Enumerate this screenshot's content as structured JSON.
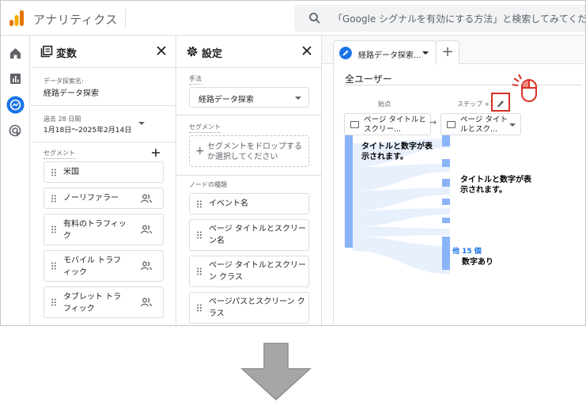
{
  "app": {
    "title": "アナリティクス"
  },
  "search": {
    "placeholder": "「Google シグナルを有効にする方法」と検索してみてください"
  },
  "variables_panel": {
    "title": "変数",
    "exploration_name_label": "データ探索名:",
    "exploration_name": "経路データ探索",
    "date_range_label": "過去 28 日間",
    "date_range": "1月18日〜2025年2月14日",
    "segments_label": "セグメント",
    "segments": [
      {
        "label": "米国",
        "has_people_icon": false
      },
      {
        "label": "ノーリファラー",
        "has_people_icon": true
      },
      {
        "label": "有料のトラフィック",
        "has_people_icon": true
      },
      {
        "label": "モバイル トラフィック",
        "has_people_icon": true
      },
      {
        "label": "タブレット トラフィック",
        "has_people_icon": true
      }
    ]
  },
  "settings_panel": {
    "title": "設定",
    "technique_label": "手法",
    "technique_value": "経路データ探索",
    "segment_label": "セグメント",
    "segment_drop": "セグメントをドロップするか選択してください",
    "node_type_label": "ノードの種類",
    "node_types": [
      "イベント名",
      "ページ タイトルとスクリーン名",
      "ページ タイトルとスクリーン クラス",
      "ページパスとスクリーン クラス"
    ]
  },
  "canvas": {
    "tab_label": "経路データ探索...",
    "segment_title": "全ユーザー",
    "start_label": "始点",
    "step_label": "ステップ +1",
    "start_node": "ページ タイトルとスクリー...",
    "step_node": "ページ タイトルとスク...",
    "annotation_1": "タイトルと数字が表示されます。",
    "annotation_2": "タイトルと数字が表示されます。",
    "more_label": "他 15 個",
    "annotation_3": "数字あり"
  },
  "colors": {
    "accent": "#1a73e8",
    "flow_bar": "#8ab4f8",
    "highlight": "#d93025"
  }
}
